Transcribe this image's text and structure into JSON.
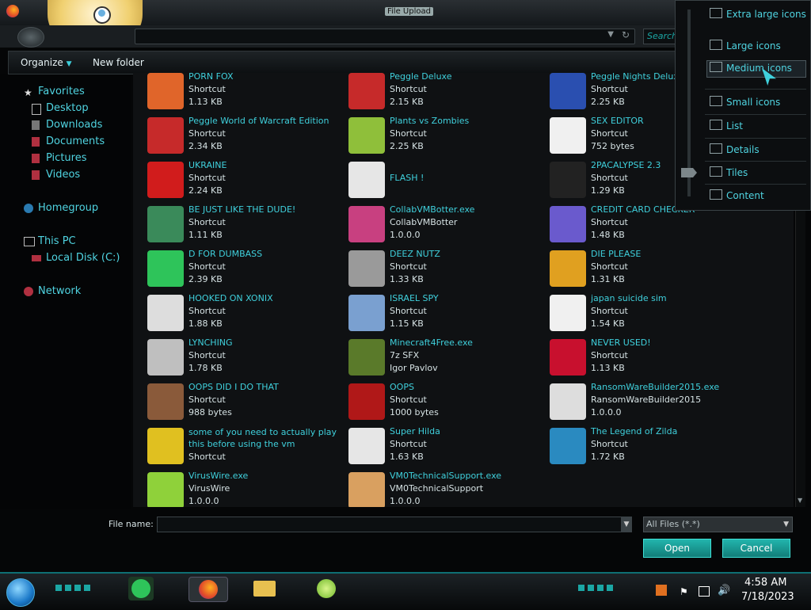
{
  "window": {
    "title": "File Upload"
  },
  "search": {
    "placeholder": "Search"
  },
  "toolbar": {
    "organize": "Organize",
    "new_folder": "New folder"
  },
  "sidebar": {
    "favorites": "Favorites",
    "desktop": "Desktop",
    "downloads": "Downloads",
    "documents": "Documents",
    "pictures": "Pictures",
    "videos": "Videos",
    "homegroup": "Homegroup",
    "this_pc": "This PC",
    "local_disk": "Local Disk (C:)",
    "network": "Network"
  },
  "files": [
    {
      "name": "PORN FOX",
      "line2": "Shortcut",
      "line3": "1.13 KB",
      "icon": "firefox-icon",
      "color": "#e0652a"
    },
    {
      "name": "Peggle Deluxe",
      "line2": "Shortcut",
      "line3": "2.15 KB",
      "icon": "peggle-icon",
      "color": "#c62a2a"
    },
    {
      "name": "Peggle Nights Deluxe",
      "line2": "Shortcut",
      "line3": "2.25 KB",
      "icon": "peggle-nights-icon",
      "color": "#2a4fb0"
    },
    {
      "name": "Peggle World of Warcraft Edition",
      "line2": "Shortcut",
      "line3": "2.34 KB",
      "icon": "peggle-wow-icon",
      "color": "#c62a2a"
    },
    {
      "name": "Plants vs Zombies",
      "line2": "Shortcut",
      "line3": "2.25 KB",
      "icon": "pvz-icon",
      "color": "#8fbf3a"
    },
    {
      "name": "SEX EDITOR",
      "line2": "Shortcut",
      "line3": "752 bytes",
      "icon": "hxd-icon",
      "color": "#f0f0f0"
    },
    {
      "name": "UKRAINE",
      "line2": "Shortcut",
      "line3": "2.24 KB",
      "icon": "radiation-icon",
      "color": "#d11c1c"
    },
    {
      "name": "FLASH !",
      "line2": "",
      "line3": "",
      "icon": "flash-icon",
      "color": "#e6e6e6"
    },
    {
      "name": "2PACALYPSE 2.3",
      "line2": "Shortcut",
      "line3": "1.29 KB",
      "icon": "terminal-icon",
      "color": "#222222"
    },
    {
      "name": "BE JUST LIKE THE DUDE!",
      "line2": "Shortcut",
      "line3": "1.11 KB",
      "icon": "santa-icon",
      "color": "#3a8a5a"
    },
    {
      "name": "CollabVMBotter.exe",
      "line2": "CollabVMBotter",
      "line3": "1.0.0.0",
      "icon": "monitor-icon",
      "color": "#c84080"
    },
    {
      "name": "CREDIT CARD CHECKER",
      "line2": "Shortcut",
      "line3": "1.48 KB",
      "icon": "credit-card-icon",
      "color": "#6a5acd"
    },
    {
      "name": "D FOR DUMBASS",
      "line2": "Shortcut",
      "line3": "2.39 KB",
      "icon": "chat-icon",
      "color": "#2ec45a"
    },
    {
      "name": "DEEZ NUTZ",
      "line2": "Shortcut",
      "line3": "1.33 KB",
      "icon": "windows-stack-icon",
      "color": "#9a9a9a"
    },
    {
      "name": "DIE PLEASE",
      "line2": "Shortcut",
      "line3": "1.31 KB",
      "icon": "de-icon",
      "color": "#e0a020"
    },
    {
      "name": "HOOKED ON XONIX",
      "line2": "Shortcut",
      "line3": "1.88 KB",
      "icon": "xonix-icon",
      "color": "#dddddd"
    },
    {
      "name": "ISRAEL SPY",
      "line2": "Shortcut",
      "line3": "1.15 KB",
      "icon": "network-icon",
      "color": "#7aa0d0"
    },
    {
      "name": "japan suicide sim",
      "line2": "Shortcut",
      "line3": "1.54 KB",
      "icon": "japan-icon",
      "color": "#f0f0f0"
    },
    {
      "name": "LYNCHING",
      "line2": "Shortcut",
      "line3": "1.78 KB",
      "icon": "noose-icon",
      "color": "#bfbfbf"
    },
    {
      "name": "Minecraft4Free.exe",
      "line2": "7z SFX",
      "line3": "Igor Pavlov",
      "icon": "grass-block-icon",
      "color": "#5a7a2a"
    },
    {
      "name": "NEVER USED!",
      "line2": "Shortcut",
      "line3": "1.13 KB",
      "icon": "devcpp-icon",
      "color": "#c8102e"
    },
    {
      "name": "OOPS DID I DO THAT",
      "line2": "Shortcut",
      "line3": "988 bytes",
      "icon": "portrait-icon",
      "color": "#8a5a3a"
    },
    {
      "name": "OOPS",
      "line2": "Shortcut",
      "line3": "1000 bytes",
      "icon": "evil-monitor-icon",
      "color": "#b01818"
    },
    {
      "name": "RansomWareBuilder2015.exe",
      "line2": "RansomWareBuilder2015",
      "line3": "1.0.0.0",
      "icon": "skull-icon",
      "color": "#dddddd"
    },
    {
      "name": "some of you need to actually play this before using the vm",
      "line2": "Shortcut",
      "line3": "",
      "icon": "dog-icon",
      "color": "#e0c020"
    },
    {
      "name": "Super Hilda",
      "line2": "Shortcut",
      "line3": "1.63 KB",
      "icon": "pixel-cat-icon",
      "color": "#e6e6e6"
    },
    {
      "name": "The Legend of Zilda",
      "line2": "Shortcut",
      "line3": "1.72 KB",
      "icon": "pixel-hero-icon",
      "color": "#2a8ac0"
    },
    {
      "name": "VirusWire.exe",
      "line2": "VirusWire",
      "line3": "1.0.0.0",
      "icon": "lime-icon",
      "color": "#8fd13a"
    },
    {
      "name": "VM0TechnicalSupport.exe",
      "line2": "VM0TechnicalSupport",
      "line3": "1.0.0.0",
      "icon": "support-person-icon",
      "color": "#d9a060"
    }
  ],
  "bottom": {
    "file_name_label": "File name:",
    "file_name_value": "",
    "filter": "All Files (*.*)",
    "open": "Open",
    "cancel": "Cancel"
  },
  "view_menu": {
    "items": [
      "Extra large icons",
      "Large icons",
      "Medium icons",
      "Small icons",
      "List",
      "Details",
      "Tiles",
      "Content"
    ],
    "selected": "Medium icons"
  },
  "clock": {
    "time": "4:58 AM",
    "date": "7/18/2023"
  },
  "colors": {
    "accent": "#1ba6a4",
    "link": "#3fd0dc",
    "taskbar_border": "#0e6f74"
  }
}
